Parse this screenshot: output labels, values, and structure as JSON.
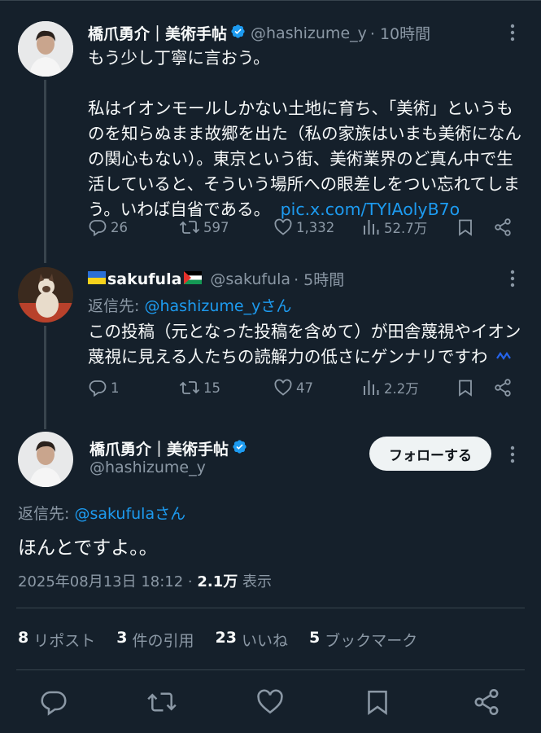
{
  "colors": {
    "background": "#15202b",
    "text": "#f7f9f9",
    "muted": "#8b98a5",
    "link": "#1d9bf0",
    "verified": "#1d9bf0",
    "divider": "#38444d"
  },
  "tweet1": {
    "name": "橋爪勇介｜美術手帖",
    "handle": "@hashizume_y",
    "time": "· 10時間",
    "text_line1": "もう少し丁寧に言おう。",
    "text_para": "私はイオンモールしかない土地に育ち、「美術」というものを知らぬまま故郷を出た（私の家族はいまも美術になんの関心もない）。東京という街、美術業界のど真ん中で生活していると、そういう場所への眼差しをつい忘れてしまう。いわば自省である。",
    "link": "pic.x.com/TYIAolyB7o",
    "replies": "26",
    "reposts": "597",
    "likes": "1,332",
    "views": "52.7万"
  },
  "tweet2": {
    "name": "sakufula",
    "handle": "@sakufula",
    "time": "· 5時間",
    "reply_prefix": "返信先: ",
    "reply_handle": "@hashizume_yさん",
    "text": "この投稿（元となった投稿を含めて）が田舎蔑視やイオン蔑視に見える人たちの読解力の低さにゲンナリですわ",
    "replies": "1",
    "reposts": "15",
    "likes": "47",
    "views": "2.2万"
  },
  "main": {
    "name": "橋爪勇介｜美術手帖",
    "handle": "@hashizume_y",
    "follow_label": "フォローする",
    "reply_prefix": "返信先: ",
    "reply_handle": "@sakufulaさん",
    "text": "ほんとですよ。。",
    "timestamp": "2025年08月13日 18:12 · ",
    "views_num": "2.1万",
    "views_label": " 表示",
    "stats": {
      "reposts_num": "8",
      "reposts_label": "リポスト",
      "quotes_num": "3",
      "quotes_label": "件の引用",
      "likes_num": "23",
      "likes_label": "いいね",
      "bookmarks_num": "5",
      "bookmarks_label": "ブックマーク"
    }
  },
  "icons": [
    "reply-icon",
    "repost-icon",
    "like-icon",
    "views-icon",
    "bookmark-icon",
    "share-icon",
    "more-icon",
    "verified-icon"
  ]
}
